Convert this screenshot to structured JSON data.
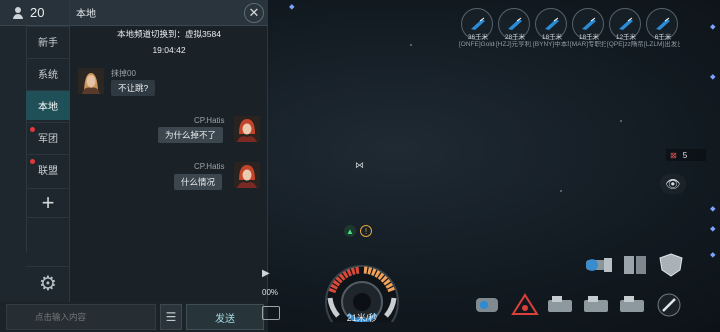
{
  "chat": {
    "online_count": "20",
    "tabs": [
      {
        "label": "新手",
        "alert": false
      },
      {
        "label": "系统",
        "alert": false
      },
      {
        "label": "本地",
        "alert": false,
        "active": true
      },
      {
        "label": "军团",
        "alert": true
      },
      {
        "label": "联盟",
        "alert": true
      }
    ],
    "add_tab_label": "+",
    "channel_title": "本地",
    "close_label": "✕",
    "system_message": "本地频道切换到：虚拟3584",
    "timestamp": "19:04:42",
    "messages": [
      {
        "sender": "抹掉00",
        "text": "不让跳?",
        "side": "left"
      },
      {
        "sender": "CP.Hatis",
        "text": "为什么掉不了",
        "side": "right"
      },
      {
        "sender": "CP.Hatis",
        "text": "什么情况",
        "side": "right"
      }
    ],
    "input_placeholder": "点击输入内容",
    "list_button_label": "☰",
    "send_label": "发送"
  },
  "hud": {
    "targets": [
      {
        "distance": "36千米",
        "label": "[ONFE]Goldenwell 促进机"
      },
      {
        "distance": "28千米",
        "label": "[HZJ]元亨利贞"
      },
      {
        "distance": "18千米",
        "label": "[BYNY]中本聪标"
      },
      {
        "distance": "18千米",
        "label": "[MAR]专职扫描"
      },
      {
        "distance": "12千米",
        "label": "[QPE]zz隋帝 [2"
      },
      {
        "distance": "6千米",
        "label": "[LZLM]出发出发"
      }
    ],
    "count": "5",
    "speed": "21米/秒",
    "zoom_percent": "00%",
    "accent_color": "#2a8bd6",
    "alert_color": "#e03a3a"
  }
}
